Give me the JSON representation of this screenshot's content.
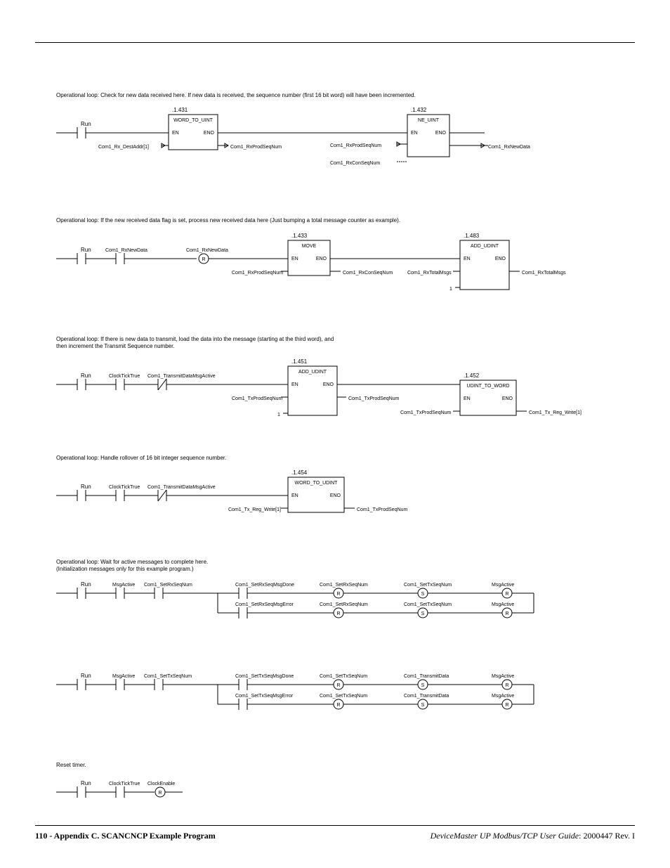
{
  "rung1": {
    "comment": "Operational loop: Check for new data received here. If new data is received, the sequence number (first 16 bit word) will have been incremented.",
    "block1_id": ".1.431",
    "block1_name": "WORD_TO_UINT",
    "block2_id": ".1.432",
    "block2_name": "NE_UINT",
    "en": "EN",
    "eno": "ENO",
    "contact_run": "Run",
    "in1": "Com1_Rx_DestAddr[1]",
    "out1": "Com1_RxProdSeqNum",
    "in2a": "Com1_RxProdSeqNum",
    "in2b": "Com1_RxConSeqNum",
    "out2": "Com1_RxNewData"
  },
  "rung2": {
    "comment": "Operational loop: If the new received data flag is set, process new received data here (Just bumping a total message counter as example).",
    "contact_run": "Run",
    "contact2": "Com1_RxNewData",
    "coil_r": "Com1_RxNewData",
    "block1_id": ".1.433",
    "block1_name": "MOVE",
    "block2_id": ".1.483",
    "block2_name": "ADD_UDINT",
    "en": "EN",
    "eno": "ENO",
    "in1": "Com1_RxProdSeqNum",
    "out1": "Com1_RxConSeqNum",
    "in2a": "Com1_RxTotalMsgs",
    "in2b": "1",
    "out2": "Com1_RxTotalMsgs"
  },
  "rung3": {
    "comment": "Operational loop: If there is new data to transmit, load the data into the message (starting at the third word), and\nthen increment the Transmit Sequence number.",
    "contact_run": "Run",
    "contact2": "ClockTickTrue",
    "contact3": "Com1_TransmitDataMsgActive",
    "block1_id": ".1.451",
    "block1_name": "ADD_UDINT",
    "block2_id": ".1.452",
    "block2_name": "UDINT_TO_WORD",
    "en": "EN",
    "eno": "ENO",
    "in1a": "Com1_TxProdSeqNum",
    "in1b": "1",
    "out1": "Com1_TxProdSeqNum",
    "in2": "Com1_TxProdSeqNum",
    "out2": "Com1_Tx_Reg_Write[1]"
  },
  "rung4": {
    "comment": "Operational loop: Handle rollover of 16 bit integer sequence number.",
    "contact_run": "Run",
    "contact2": "ClockTickTrue",
    "contact3": "Com1_TransmitDataMsgActive",
    "block1_id": ".1.454",
    "block1_name": "WORD_TO_UDINT",
    "en": "EN",
    "eno": "ENO",
    "in1": "Com1_Tx_Reg_Write[1]",
    "out1": "Com1_TxProdSeqNum"
  },
  "rung5": {
    "comment": "Operational loop: Wait for active messages to complete here.\n(Initialization messages only for this example program.)",
    "row1": {
      "c1": "Run",
      "c2": "MsgActive",
      "c3": "Com1_SetRxSeqNum",
      "done": "Com1_SetRxSeqMsgDone",
      "err": "Com1_SetRxSeqMsgError",
      "r1": "Com1_SetRxSeqNum",
      "r2": "Com1_SetRxSeqNum",
      "s1": "Com1_SetTxSeqNum",
      "s2": "Com1_SetTxSeqNum",
      "ma1": "MsgActive",
      "ma2": "MsgActive"
    },
    "row2": {
      "c1": "Run",
      "c2": "MsgActive",
      "c3": "Com1_SetTxSeqNum",
      "done": "Com1_SetTxSeqMsgDone",
      "err": "Com1_SetTxSeqMsgError",
      "r1": "Com1_SetTxSeqNum",
      "r2": "Com1_SetTxSeqNum",
      "s1": "Com1_TransmitData",
      "s2": "Com1_TransmitData",
      "ma1": "MsgActive",
      "ma2": "MsgActive"
    }
  },
  "rung6": {
    "comment": "Reset timer.",
    "c1": "Run",
    "c2": "ClockTickTrue",
    "coil": "ClockEnable"
  },
  "footer": {
    "left": "110 - Appendix C. SCANCNCP Example Program",
    "right_title": "DeviceMaster UP Modbus/TCP User Guide",
    "right_rev": ": 2000447 Rev. I"
  }
}
